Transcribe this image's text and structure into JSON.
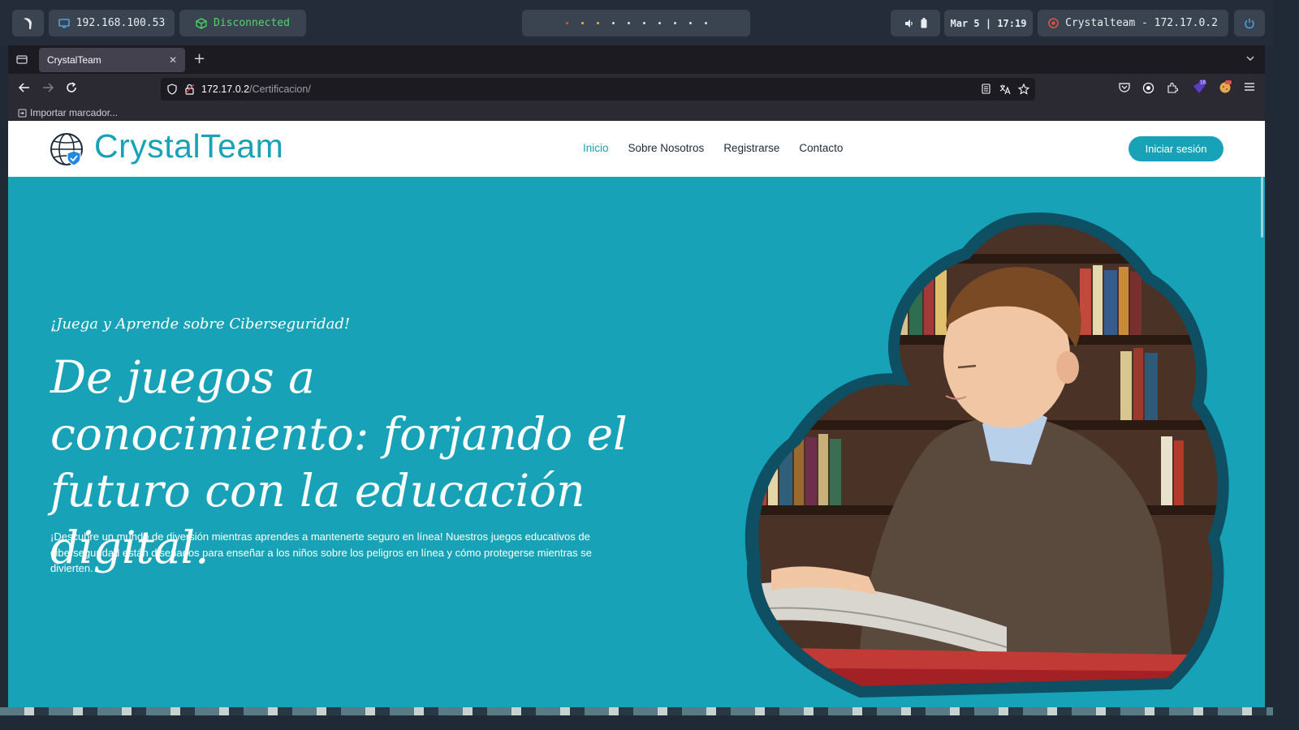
{
  "desktop": {
    "ip": "192.168.100.53",
    "vpn_status": "Disconnected",
    "datetime": "Mar 5 | 17:19",
    "target": "Crystalteam - 172.17.0.2",
    "workspace_dot_colors": [
      "#e0524a",
      "#e3b93a",
      "#e3b93a",
      "#d8dde4",
      "#d8dde4",
      "#d8dde4",
      "#d8dde4",
      "#d8dde4",
      "#d8dde4",
      "#d8dde4"
    ]
  },
  "browser": {
    "tab_title": "CrystalTeam",
    "url_host": "172.17.0.2",
    "url_path": "/Certificacion/",
    "bookmark_import": "Importar marcador...",
    "extension_badge": "16"
  },
  "site": {
    "brand": "CrystalTeam",
    "nav": [
      "Inicio",
      "Sobre Nosotros",
      "Registrarse",
      "Contacto"
    ],
    "login": "Iniciar sesión",
    "kicker": "¡Juega y Aprende sobre Ciberseguridad!",
    "title": "De juegos a conocimiento: forjando el futuro con la educación digital.",
    "description": "¡Descubre un mundo de diversión mientras aprendes a mantenerte seguro en línea! Nuestros juegos educativos de ciberseguridad están diseñados para enseñar a los niños sobre los peligros en línea y cómo protegerse mientras se divierten."
  },
  "colors": {
    "accent": "#17a2b8",
    "hero_frame": "#0e4f63",
    "vpn_green": "#4fd66b"
  }
}
